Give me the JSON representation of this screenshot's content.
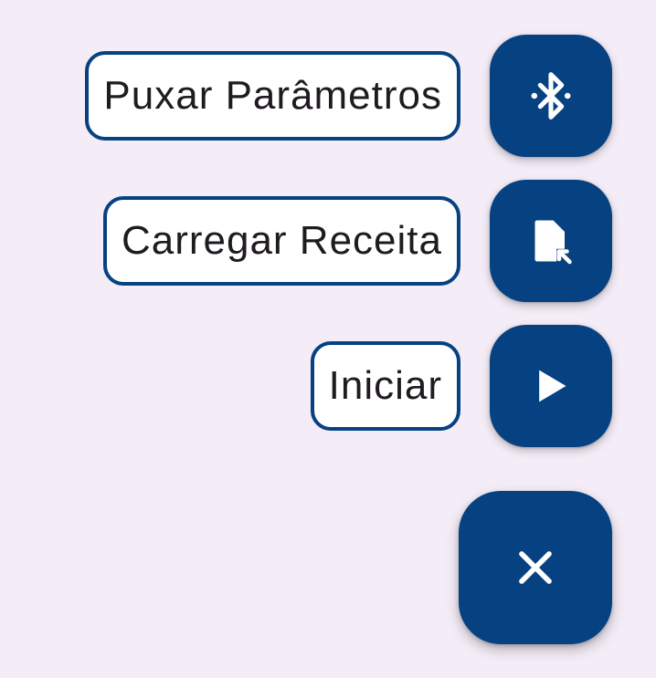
{
  "speed_dial": {
    "actions": [
      {
        "label": "Puxar Parâmetros",
        "icon": "bluetooth-icon"
      },
      {
        "label": "Carregar Receita",
        "icon": "file-open-icon"
      },
      {
        "label": "Iniciar",
        "icon": "play-icon"
      }
    ],
    "main_fab": {
      "icon": "close-icon"
    }
  },
  "colors": {
    "background": "#f4ecf6",
    "fab": "#064282",
    "chip_border": "#064282",
    "chip_bg": "#ffffff",
    "text": "#1f1b20",
    "icon": "#ffffff"
  }
}
